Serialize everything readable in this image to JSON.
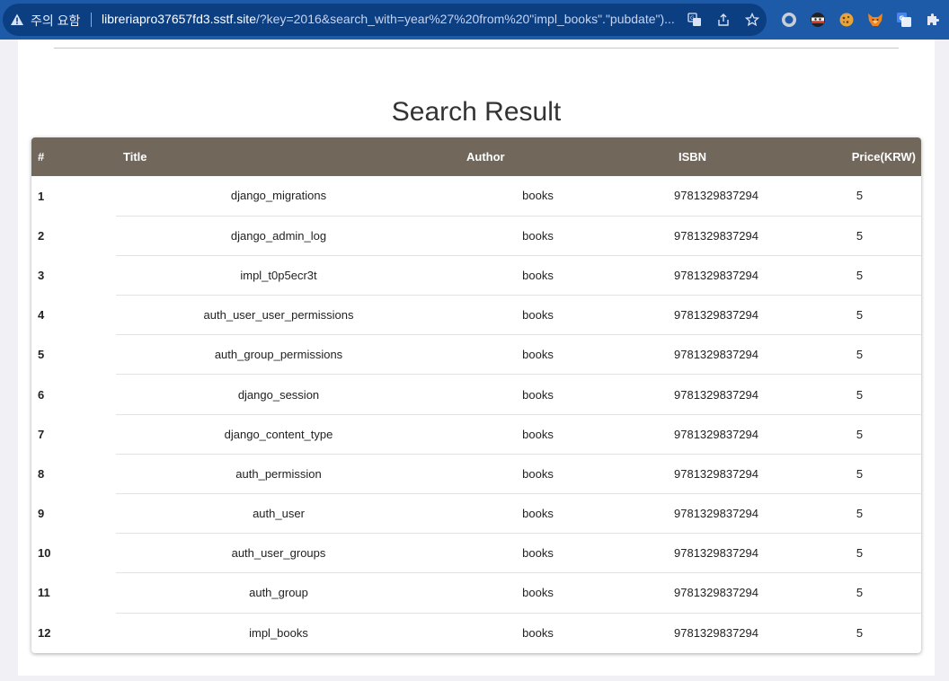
{
  "browser": {
    "security_warning": "주의 요함",
    "url_host": "libreriapro37657fd3.sstf.site",
    "url_rest": "/?key=2016&search_with=year%27%20from%20\"impl_books\".\"pubdate\")...",
    "omnibox_icons": [
      "translate-icon",
      "share-icon",
      "bookmark-star-icon"
    ],
    "extension_icons": [
      "record-circle-icon",
      "ninja-extension-icon",
      "cookie-extension-icon",
      "fox-extension-icon",
      "google-translate-extension-icon",
      "puzzle-extensions-icon"
    ]
  },
  "page": {
    "heading": "Search Result",
    "table": {
      "columns": [
        "#",
        "Title",
        "Author",
        "ISBN",
        "Price(KRW)"
      ],
      "rows": [
        {
          "num": "1",
          "title": "django_migrations",
          "author": "books",
          "isbn": "9781329837294",
          "price": "5"
        },
        {
          "num": "2",
          "title": "django_admin_log",
          "author": "books",
          "isbn": "9781329837294",
          "price": "5"
        },
        {
          "num": "3",
          "title": "impl_t0p5ecr3t",
          "author": "books",
          "isbn": "9781329837294",
          "price": "5"
        },
        {
          "num": "4",
          "title": "auth_user_user_permissions",
          "author": "books",
          "isbn": "9781329837294",
          "price": "5"
        },
        {
          "num": "5",
          "title": "auth_group_permissions",
          "author": "books",
          "isbn": "9781329837294",
          "price": "5"
        },
        {
          "num": "6",
          "title": "django_session",
          "author": "books",
          "isbn": "9781329837294",
          "price": "5"
        },
        {
          "num": "7",
          "title": "django_content_type",
          "author": "books",
          "isbn": "9781329837294",
          "price": "5"
        },
        {
          "num": "8",
          "title": "auth_permission",
          "author": "books",
          "isbn": "9781329837294",
          "price": "5"
        },
        {
          "num": "9",
          "title": "auth_user",
          "author": "books",
          "isbn": "9781329837294",
          "price": "5"
        },
        {
          "num": "10",
          "title": "auth_user_groups",
          "author": "books",
          "isbn": "9781329837294",
          "price": "5"
        },
        {
          "num": "11",
          "title": "auth_group",
          "author": "books",
          "isbn": "9781329837294",
          "price": "5"
        },
        {
          "num": "12",
          "title": "impl_books",
          "author": "books",
          "isbn": "9781329837294",
          "price": "5"
        }
      ]
    }
  },
  "colors": {
    "browser_frame": "#1d5ba8",
    "omnibox": "#0c3e82",
    "table_header": "#72675b",
    "page_background": "#f1f0f5"
  }
}
